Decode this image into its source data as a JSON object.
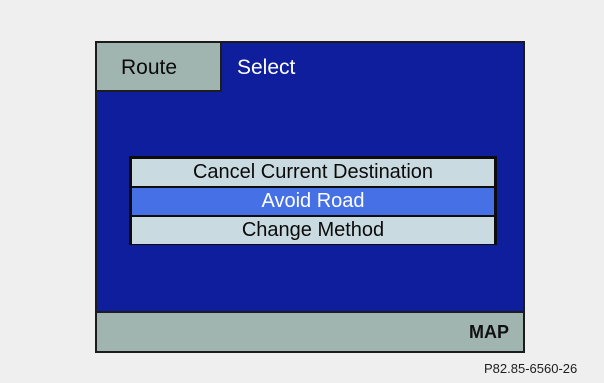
{
  "header": {
    "tab_label": "Route",
    "title": "Select"
  },
  "menu": {
    "items": [
      {
        "label": "Cancel Current Destination",
        "selected": false
      },
      {
        "label": "Avoid Road",
        "selected": true
      },
      {
        "label": "Change Method",
        "selected": false
      }
    ]
  },
  "footer": {
    "map_label": "MAP"
  },
  "figure_code": "P82.85-6560-26",
  "colors": {
    "screen_background": "#0e1e9c",
    "bar_background": "#a1b5b0",
    "item_background": "#c9dbe0",
    "selected_item_background": "#4670e6"
  }
}
